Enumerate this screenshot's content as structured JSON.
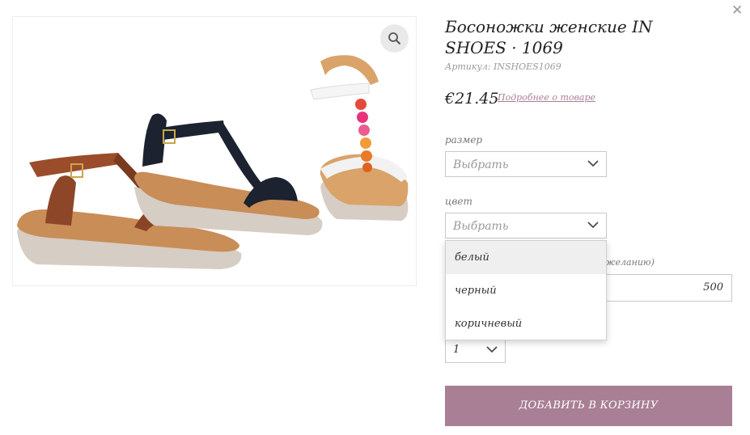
{
  "close_icon": "close-icon",
  "product": {
    "title": "Босоножки женские IN SHOES · 1069",
    "sku_label": "Артикул:",
    "sku": "INSHOES1069",
    "price": "€21.45",
    "more_link": "Подробнее о товаре",
    "image_alt_icon": "sandals-image"
  },
  "size": {
    "label": "размер",
    "value": "Выбрать"
  },
  "color": {
    "label": "цвет",
    "value": "Выбрать",
    "options": [
      "белый",
      "черный",
      "коричневый"
    ]
  },
  "partial_label": "желанию)",
  "amount_value": "500",
  "quantity": {
    "value": "1"
  },
  "add_to_cart": "ДОБАВИТЬ В КОРЗИНУ",
  "colors": {
    "accent": "#a87f94",
    "border": "#c9c9c9"
  }
}
